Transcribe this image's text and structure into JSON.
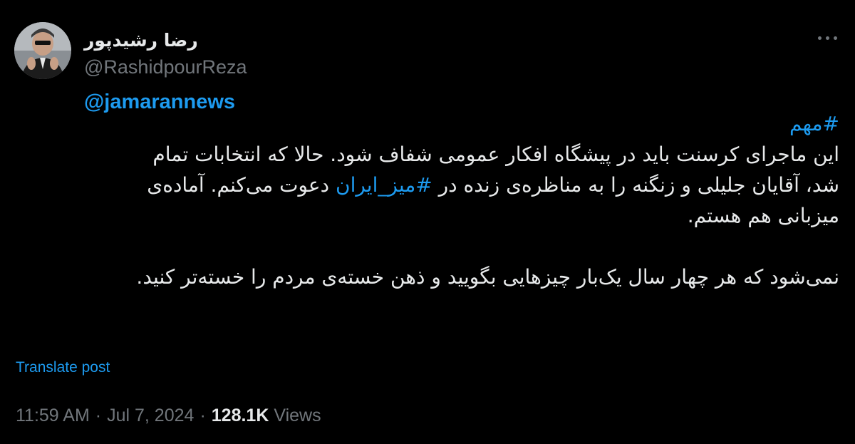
{
  "author": {
    "display_name": "رضا رشیدپور",
    "handle": "@RashidpourReza"
  },
  "reply_mention": "@jamarannews",
  "body": {
    "hashtag_top": "#مهم",
    "para1_line1": "این ماجرای کرسنت باید در پیشگاه افکار عمومی شفاف شود. حالا که انتخابات تمام",
    "para1_line2_start": "شد، آقایان جلیلی و زنگنه را به مناظره‌ی زنده در ",
    "para1_hashtag": "#میز_ایران",
    "para1_line2_end": " دعوت می‌کنم. آماده‌ی",
    "para1_line3": "میزبانی هم هستم.",
    "para2": "نمی‌شود که هر چهار سال یک‌بار چیزهایی بگویید و ذهن خسته‌ی مردم را خسته‌تر کنید."
  },
  "translate_label": "Translate post",
  "meta": {
    "time": "11:59 AM",
    "date": "Jul 7, 2024",
    "views_count": "128.1K",
    "views_label": "Views",
    "separator": "·"
  },
  "colors": {
    "background": "#000000",
    "text": "#e7e9ea",
    "secondary": "#71767b",
    "accent": "#1d9bf0"
  },
  "icons": {
    "more": "more-horizontal-icon",
    "avatar": "profile-avatar"
  }
}
